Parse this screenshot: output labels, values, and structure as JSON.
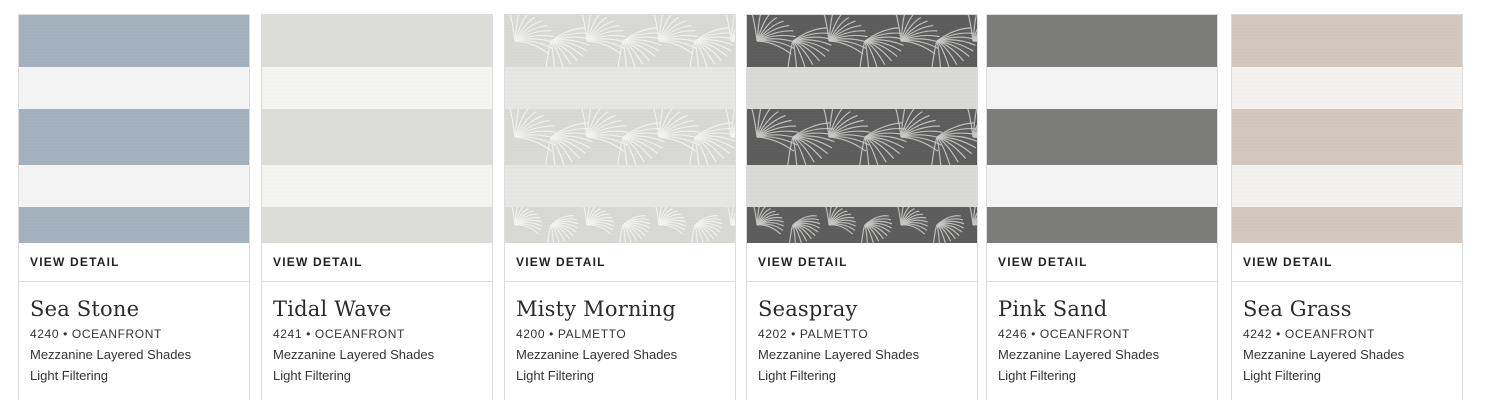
{
  "products": [
    {
      "name": "Sea Stone",
      "code": "4240",
      "collection": "OCEANFRONT",
      "line": "Mezzanine Layered Shades",
      "opacity": "Light Filtering",
      "view_label": "VIEW DETAIL",
      "swatch": {
        "pattern": "solid",
        "band": "#a4b1bf",
        "band_dark": "#8e9dac",
        "sheer": "#f3f3f3"
      }
    },
    {
      "name": "Tidal Wave",
      "code": "4241",
      "collection": "OCEANFRONT",
      "line": "Mezzanine Layered Shades",
      "opacity": "Light Filtering",
      "view_label": "VIEW DETAIL",
      "swatch": {
        "pattern": "solid",
        "band": "#dcddd8",
        "band_dark": "#d1d2cd",
        "sheer": "#f4f4f2"
      }
    },
    {
      "name": "Misty Morning",
      "code": "4200",
      "collection": "PALMETTO",
      "line": "Mezzanine Layered Shades",
      "opacity": "Light Filtering",
      "view_label": "VIEW DETAIL",
      "swatch": {
        "pattern": "palm",
        "band": "#d9dad6",
        "band_dark": "#c6c8c3",
        "sheer": "#e6e6e4",
        "leaf": "#f2f2f0"
      }
    },
    {
      "name": "Seaspray",
      "code": "4202",
      "collection": "PALMETTO",
      "line": "Mezzanine Layered Shades",
      "opacity": "Light Filtering",
      "view_label": "VIEW DETAIL",
      "swatch": {
        "pattern": "palm",
        "band": "#5e5e5e",
        "band_dark": "#4a4a4a",
        "sheer": "#dadad8",
        "leaf": "#c9c9c7"
      }
    },
    {
      "name": "Pink Sand",
      "code": "4246",
      "collection": "OCEANFRONT",
      "line": "Mezzanine Layered Shades",
      "opacity": "Light Filtering",
      "view_label": "VIEW DETAIL",
      "swatch": {
        "pattern": "solid",
        "band": "#7d7d7b",
        "band_dark": "#6c6c6a",
        "sheer": "#f3f3f3"
      }
    },
    {
      "name": "Sea Grass",
      "code": "4242",
      "collection": "OCEANFRONT",
      "line": "Mezzanine Layered Shades",
      "opacity": "Light Filtering",
      "view_label": "VIEW DETAIL",
      "swatch": {
        "pattern": "solid",
        "band": "#d2c8bd",
        "band_dark": "#c6bcb1",
        "sheer": "#f4f2f0"
      }
    }
  ]
}
